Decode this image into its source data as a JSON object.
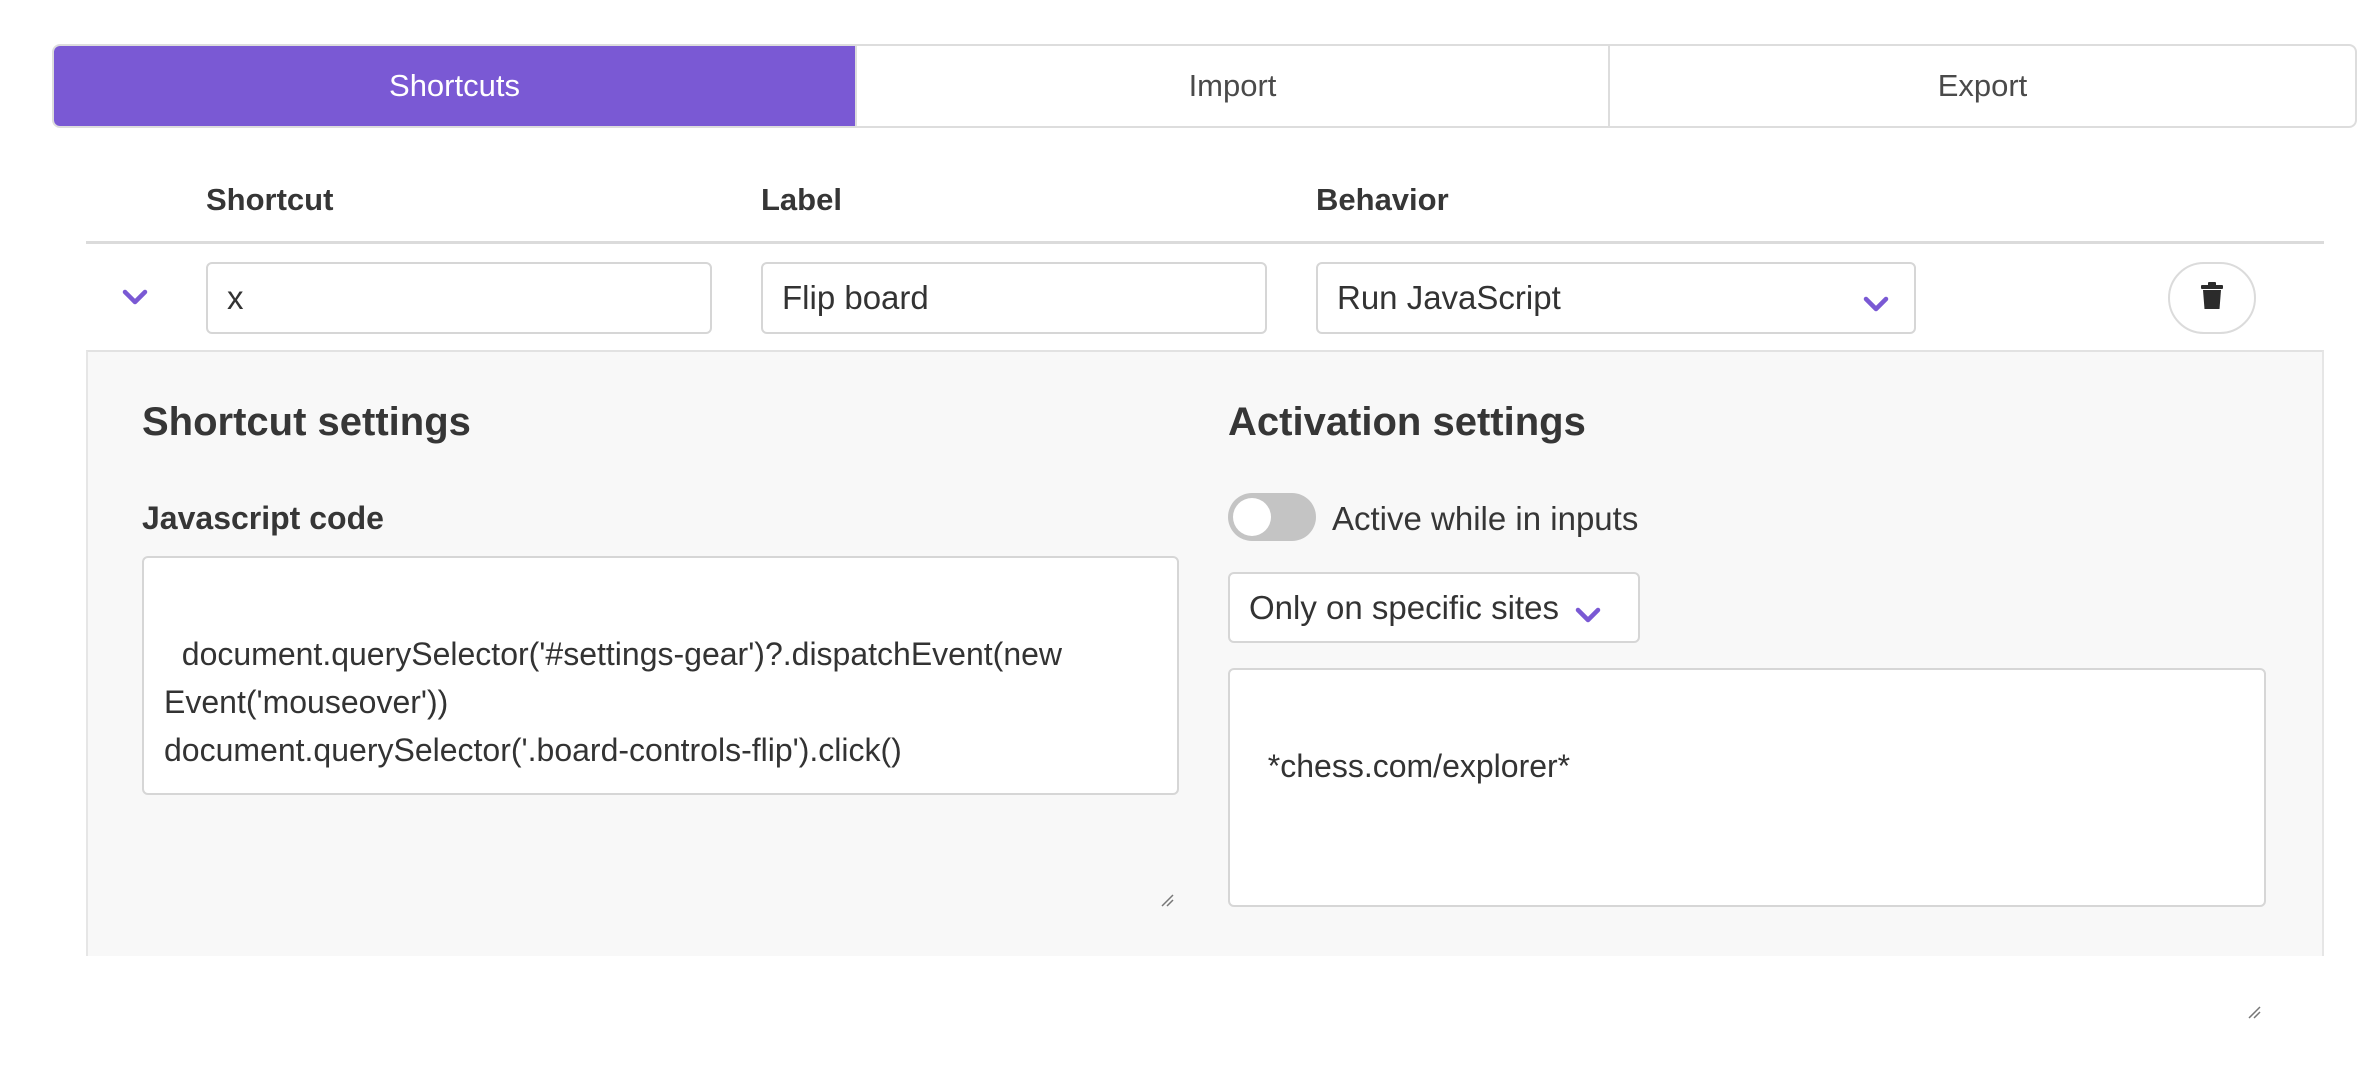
{
  "tabs": [
    {
      "label": "Shortcuts",
      "active": true
    },
    {
      "label": "Import",
      "active": false
    },
    {
      "label": "Export",
      "active": false
    }
  ],
  "table": {
    "headers": {
      "shortcut": "Shortcut",
      "label": "Label",
      "behavior": "Behavior"
    },
    "row": {
      "shortcut": "x",
      "label": "Flip board",
      "behavior": "Run JavaScript"
    }
  },
  "shortcut_settings": {
    "title": "Shortcut settings",
    "code_label": "Javascript code",
    "code": "document.querySelector('#settings-gear')?.dispatchEvent(new\nEvent('mouseover'))\ndocument.querySelector('.board-controls-flip').click()"
  },
  "activation_settings": {
    "title": "Activation settings",
    "toggle_label": "Active while in inputs",
    "toggle_on": false,
    "site_mode": "Only on specific sites",
    "sites": "*chess.com/explorer*"
  },
  "colors": {
    "accent": "#7a59d4",
    "panel_bg": "#f8f8f8",
    "border": "#d6d6d6"
  }
}
